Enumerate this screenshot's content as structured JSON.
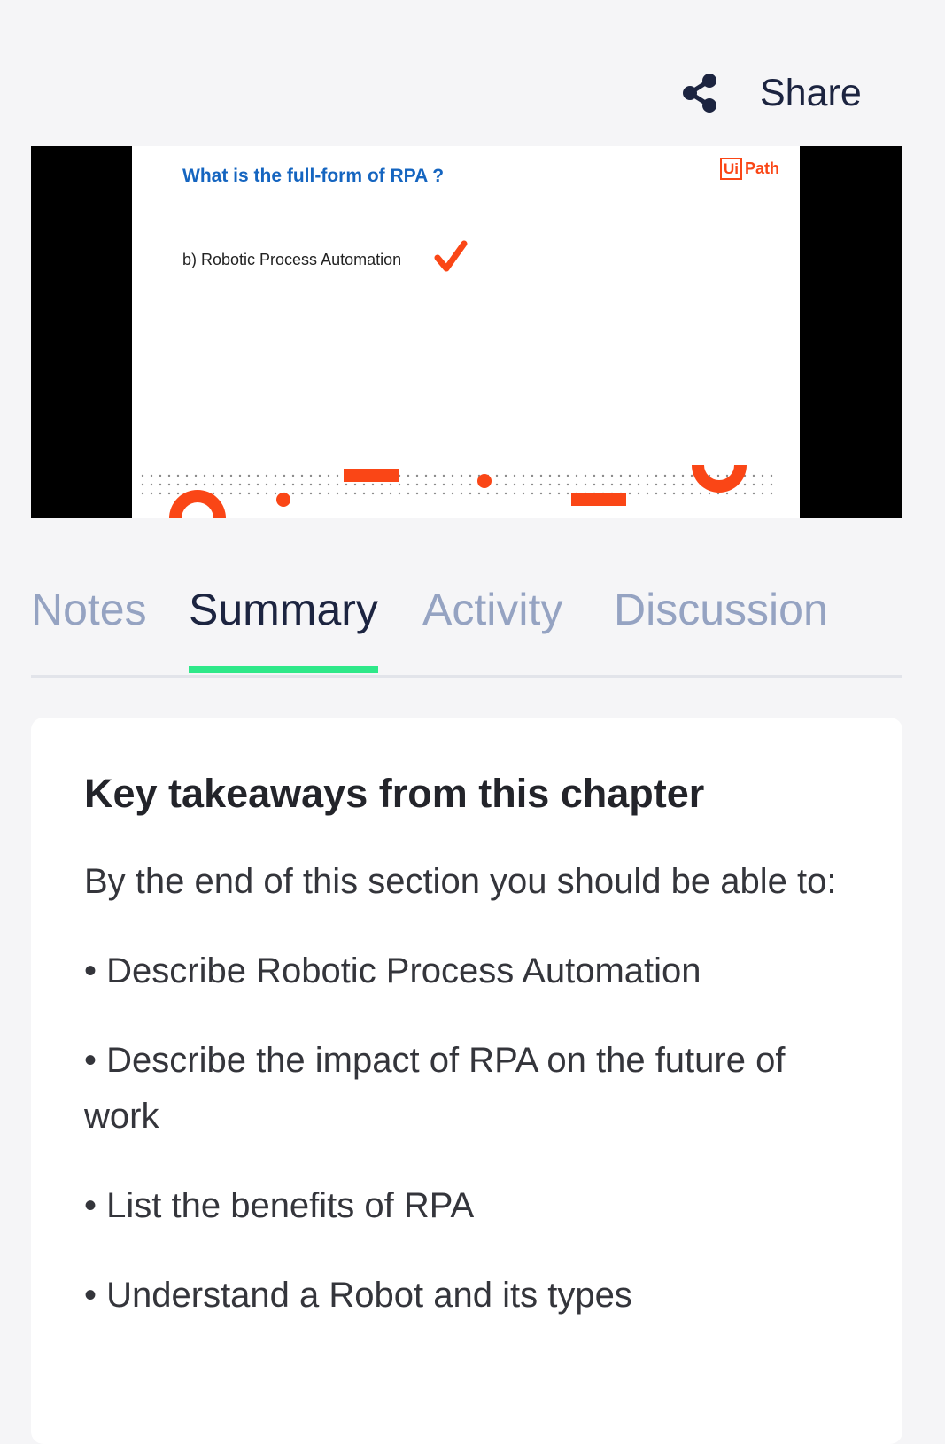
{
  "share": {
    "label": "Share",
    "icon": "share-icon"
  },
  "video": {
    "slide": {
      "question": "What is the full-form of RPA ?",
      "answer": "b)  Robotic Process Automation",
      "logo_box": "Ui",
      "logo_word": "Path",
      "accent_color": "#fa4616",
      "question_color": "#1565c0"
    }
  },
  "tabs": [
    {
      "label": "Notes",
      "active": false
    },
    {
      "label": "Summary",
      "active": true
    },
    {
      "label": "Activity",
      "active": false
    },
    {
      "label": "Discussion",
      "active": false
    }
  ],
  "colors": {
    "active_tab_underline": "#2ee889",
    "active_tab_text": "#1c2440",
    "inactive_tab_text": "#95a3c2"
  },
  "summary": {
    "title": "Key takeaways from this chapter",
    "intro": "By the end of this section you should be able to:",
    "bullets": [
      "• Describe Robotic Process Automation",
      "• Describe the impact of RPA on the future of work",
      "• List the benefits of RPA",
      "• Understand a Robot and its types"
    ]
  }
}
